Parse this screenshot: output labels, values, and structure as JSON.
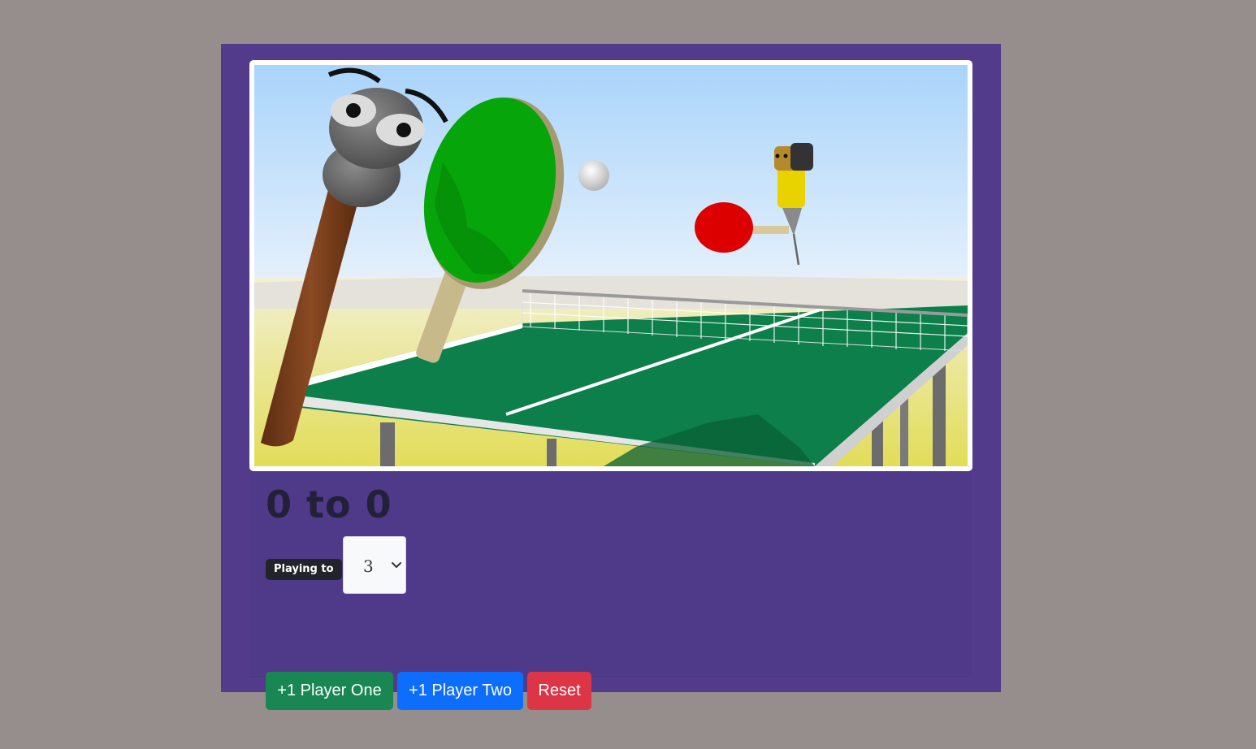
{
  "scoreboard": {
    "score_text": "0 to 0"
  },
  "settings": {
    "playing_to_label": "Playing to",
    "playing_to_value": "3"
  },
  "buttons": {
    "player_one": "+1 Player One",
    "player_two": "+1 Player Two",
    "reset": "Reset"
  },
  "colors": {
    "page_background": "#968e8c",
    "panel": "#533b8c",
    "player_one_button": "#198754",
    "player_two_button": "#0d6efd",
    "reset_button": "#dc3545"
  }
}
